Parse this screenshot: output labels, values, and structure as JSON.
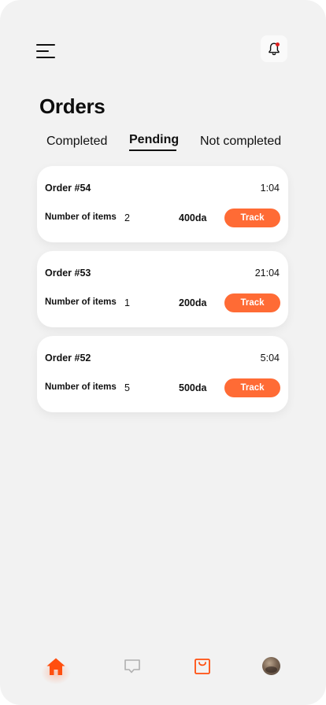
{
  "header": {
    "menu_icon": "hamburger-menu-icon",
    "bell_icon": "bell-icon",
    "has_notification": true,
    "notification_color": "#e02020"
  },
  "page": {
    "title": "Orders"
  },
  "tabs": [
    {
      "label": "Completed",
      "active": false
    },
    {
      "label": "Pending",
      "active": true
    },
    {
      "label": "Not completed",
      "active": false
    }
  ],
  "orders": [
    {
      "id": "Order #54",
      "time": "1:04",
      "items_label": "Number of items",
      "items_count": "2",
      "price": "400da",
      "action": "Track"
    },
    {
      "id": "Order #53",
      "time": "21:04",
      "items_label": "Number of items",
      "items_count": "1",
      "price": "200da",
      "action": "Track"
    },
    {
      "id": "Order #52",
      "time": "5:04",
      "items_label": "Number of items",
      "items_count": "5",
      "price": "500da",
      "action": "Track"
    }
  ],
  "bottom_nav": [
    {
      "icon": "home-icon",
      "active": true,
      "color": "#ff4f0f"
    },
    {
      "icon": "chat-icon",
      "active": false,
      "color": "#b0b0b0"
    },
    {
      "icon": "shopping-bag-icon",
      "active": false,
      "color": "#ff4f0f"
    },
    {
      "icon": "profile-avatar",
      "active": false
    }
  ],
  "colors": {
    "accent": "#ff6b35",
    "background": "#f2f2f2",
    "card": "#ffffff",
    "text": "#111111"
  }
}
